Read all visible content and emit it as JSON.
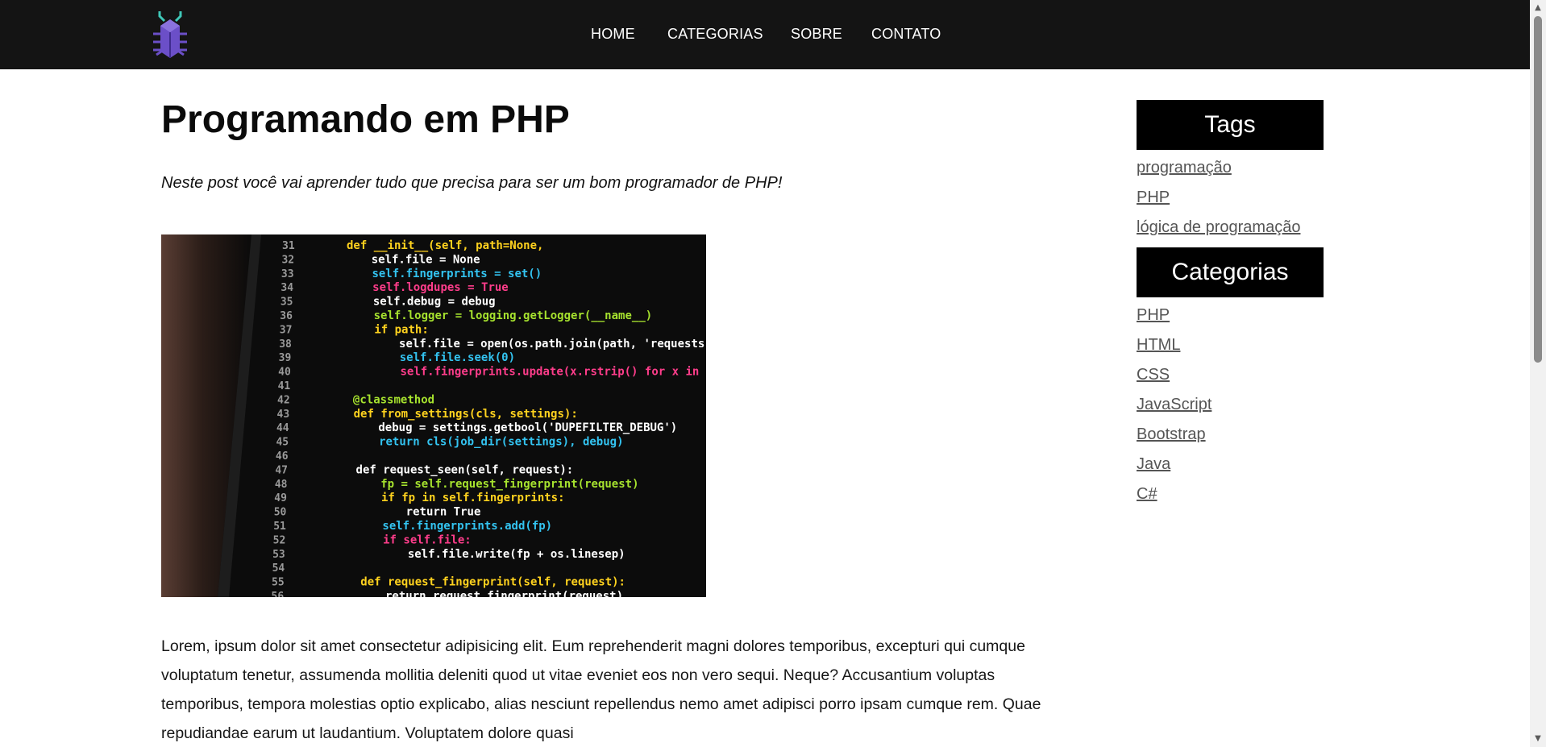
{
  "nav": {
    "items": [
      "HOME",
      "CATEGORIAS",
      "SOBRE",
      "CONTATO"
    ]
  },
  "logo": {
    "icon": "bug-icon",
    "colors": {
      "body": "#6B4FC8",
      "antenna": "#3FC8B8"
    }
  },
  "article": {
    "title": "Programando em PHP",
    "subtitle": "Neste post você vai aprender tudo que precisa para ser um bom programador de PHP!",
    "image": {
      "icon": "code-screenshot-image",
      "lines": [
        {
          "n": "31",
          "code": "def __init__(self, path=None,"
        },
        {
          "n": "32",
          "code": "self.file = None"
        },
        {
          "n": "33",
          "code": "self.fingerprints = set()"
        },
        {
          "n": "34",
          "code": "self.logdupes = True"
        },
        {
          "n": "35",
          "code": "self.debug = debug"
        },
        {
          "n": "36",
          "code": "self.logger = logging.getLogger(__name__)"
        },
        {
          "n": "37",
          "code": "if path:"
        },
        {
          "n": "38",
          "code": "self.file = open(os.path.join(path, 'requests.seen'), 'a+')"
        },
        {
          "n": "39",
          "code": "self.file.seek(0)"
        },
        {
          "n": "40",
          "code": "self.fingerprints.update(x.rstrip() for x in self.file)"
        },
        {
          "n": "41",
          "code": ""
        },
        {
          "n": "42",
          "code": "@classmethod"
        },
        {
          "n": "43",
          "code": "def from_settings(cls, settings):"
        },
        {
          "n": "44",
          "code": "debug = settings.getbool('DUPEFILTER_DEBUG')"
        },
        {
          "n": "45",
          "code": "return cls(job_dir(settings), debug)"
        },
        {
          "n": "46",
          "code": ""
        },
        {
          "n": "47",
          "code": "def request_seen(self, request):"
        },
        {
          "n": "48",
          "code": "fp = self.request_fingerprint(request)"
        },
        {
          "n": "49",
          "code": "if fp in self.fingerprints:"
        },
        {
          "n": "50",
          "code": "return True"
        },
        {
          "n": "51",
          "code": "self.fingerprints.add(fp)"
        },
        {
          "n": "52",
          "code": "if self.file:"
        },
        {
          "n": "53",
          "code": "self.file.write(fp + os.linesep)"
        },
        {
          "n": "54",
          "code": ""
        },
        {
          "n": "55",
          "code": "def request_fingerprint(self, request):"
        },
        {
          "n": "56",
          "code": "return request_fingerprint(request)"
        }
      ]
    },
    "body": "Lorem, ipsum dolor sit amet consectetur adipisicing elit. Eum reprehenderit magni dolores temporibus, excepturi qui cumque voluptatum tenetur, assumenda mollitia deleniti quod ut vitae eveniet eos non vero sequi. Neque? Accusantium voluptas temporibus, tempora molestias optio explicabo, alias nesciunt repellendus nemo amet adipisci porro ipsam cumque rem. Quae repudiandae earum ut laudantium. Voluptatem dolore quasi"
  },
  "sidebar": {
    "tags": {
      "title": "Tags",
      "items": [
        "programação",
        "PHP",
        "lógica de programação"
      ]
    },
    "categories": {
      "title": "Categorias",
      "items": [
        "PHP",
        "HTML",
        "CSS",
        "JavaScript",
        "Bootstrap",
        "Java",
        "C#"
      ]
    }
  },
  "colors": {
    "header_bg": "#141414",
    "sidebar_header_bg": "#000000",
    "link": "#555555"
  }
}
